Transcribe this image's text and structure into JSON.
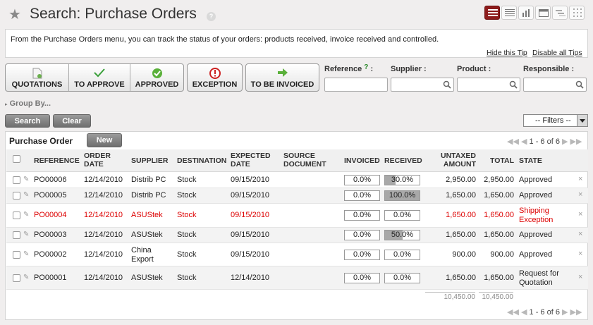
{
  "header": {
    "title": "Search: Purchase Orders",
    "help": "?",
    "views": [
      "list-view-icon",
      "grid-view-icon",
      "graph-view-icon",
      "calendar-view-icon",
      "gantt-view-icon",
      "kanban-view-icon"
    ]
  },
  "tip": {
    "text": "From the Purchase Orders menu, you can track the status of your orders: products received, invoice received and controlled.",
    "hide_link": "Hide this Tip",
    "disable_link": "Disable all Tips"
  },
  "filters": {
    "quotations": "QUOTATIONS",
    "to_approve": "TO APPROVE",
    "approved": "APPROVED",
    "exception": "EXCEPTION",
    "to_be_invoiced": "TO BE INVOICED"
  },
  "fields": {
    "reference": "Reference",
    "reference_help": "?",
    "reference_colon": ":",
    "supplier": "Supplier :",
    "product": "Product :",
    "responsible": "Responsible :"
  },
  "group_by": "Group By...",
  "actions": {
    "search": "Search",
    "clear": "Clear",
    "filters": "-- Filters --"
  },
  "list": {
    "title": "Purchase Order",
    "new_label": "New",
    "pager": "1 - 6 of 6",
    "columns": [
      "REFERENCE",
      "ORDER DATE",
      "SUPPLIER",
      "DESTINATION",
      "EXPECTED DATE",
      "SOURCE DOCUMENT",
      "INVOICED",
      "RECEIVED",
      "UNTAXED AMOUNT",
      "TOTAL",
      "STATE"
    ],
    "rows": [
      {
        "reference": "PO00006",
        "order_date": "12/14/2010",
        "supplier": "Distrib PC",
        "destination": "Stock",
        "expected": "09/15/2010",
        "source": "",
        "invoiced": "0.0%",
        "received": "30.0%",
        "received_pct": 30,
        "untaxed": "2,950.00",
        "total": "2,950.00",
        "state": "Approved"
      },
      {
        "reference": "PO00005",
        "order_date": "12/14/2010",
        "supplier": "Distrib PC",
        "destination": "Stock",
        "expected": "09/15/2010",
        "source": "",
        "invoiced": "0.0%",
        "received": "100.0%",
        "received_pct": 100,
        "untaxed": "1,650.00",
        "total": "1,650.00",
        "state": "Approved"
      },
      {
        "reference": "PO00004",
        "order_date": "12/14/2010",
        "supplier": "ASUStek",
        "destination": "Stock",
        "expected": "09/15/2010",
        "source": "",
        "invoiced": "0.0%",
        "received": "0.0%",
        "received_pct": 0,
        "untaxed": "1,650.00",
        "total": "1,650.00",
        "state": "Shipping Exception"
      },
      {
        "reference": "PO00003",
        "order_date": "12/14/2010",
        "supplier": "ASUStek",
        "destination": "Stock",
        "expected": "09/15/2010",
        "source": "",
        "invoiced": "0.0%",
        "received": "50.0%",
        "received_pct": 50,
        "untaxed": "1,650.00",
        "total": "1,650.00",
        "state": "Approved"
      },
      {
        "reference": "PO00002",
        "order_date": "12/14/2010",
        "supplier": "China Export",
        "destination": "Stock",
        "expected": "09/15/2010",
        "source": "",
        "invoiced": "0.0%",
        "received": "0.0%",
        "received_pct": 0,
        "untaxed": "900.00",
        "total": "900.00",
        "state": "Approved"
      },
      {
        "reference": "PO00001",
        "order_date": "12/14/2010",
        "supplier": "ASUStek",
        "destination": "Stock",
        "expected": "12/14/2010",
        "source": "",
        "invoiced": "0.0%",
        "received": "0.0%",
        "received_pct": 0,
        "untaxed": "1,650.00",
        "total": "1,650.00",
        "state": "Request for Quotation"
      }
    ],
    "totals": {
      "untaxed": "10,450.00",
      "total": "10,450.00"
    }
  },
  "colors": {
    "exception_row": "#dd0000",
    "active_view": "#8d1c1c"
  }
}
